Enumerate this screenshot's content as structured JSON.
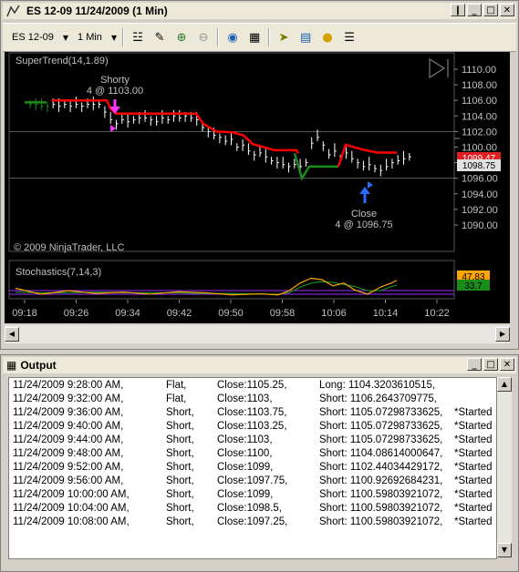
{
  "chart_window": {
    "title": "ES 12-09  11/24/2009 (1 Min)",
    "instrument": "ES 12-09",
    "interval": "1 Min",
    "indicator_label": "SuperTrend(14,1.89)",
    "copyright": "© 2009 NinjaTrader, LLC",
    "stoch_label": "Stochastics(7,14,3)",
    "entry_label": "Shorty",
    "entry_detail": "4 @ 1103.00",
    "exit_label": "Close",
    "exit_detail": "4 @ 1096.75",
    "price_ticks": [
      "1110.00",
      "1108.00",
      "1106.00",
      "1104.00",
      "1102.00",
      "1100.00",
      "1098.00",
      "1096.00",
      "1094.00",
      "1092.00",
      "1090.00"
    ],
    "time_ticks": [
      "09:18",
      "09:26",
      "09:34",
      "09:42",
      "09:50",
      "09:58",
      "10:06",
      "10:14",
      "10:22"
    ],
    "last_price": "1098.75",
    "trend_price": "1099.47",
    "stoch_k": "47.83",
    "stoch_d": "33.7",
    "colors": {
      "uptrend": "#1a8c1a",
      "downtrend": "#ff0000",
      "stoch_k": "#ffa500",
      "stoch_d": "#1a8c1a",
      "level": "#9b30ff",
      "price_bar": "#ffffff"
    }
  },
  "output_window": {
    "title": "Output",
    "rows": [
      [
        "11/24/2009 9:28:00 AM,",
        "Flat,",
        "Close:1105.25,",
        "Long: 1104.3203610515,",
        ""
      ],
      [
        "11/24/2009 9:32:00 AM,",
        "Flat,",
        "Close:1103,",
        "Short: 1106.2643709775,",
        ""
      ],
      [
        "11/24/2009 9:36:00 AM,",
        "Short,",
        "Close:1103.75,",
        "Short: 1105.07298733625,",
        "*Started"
      ],
      [
        "11/24/2009 9:40:00 AM,",
        "Short,",
        "Close:1103.25,",
        "Short: 1105.07298733625,",
        "*Started"
      ],
      [
        "11/24/2009 9:44:00 AM,",
        "Short,",
        "Close:1103,",
        "Short: 1105.07298733625,",
        "*Started"
      ],
      [
        "11/24/2009 9:48:00 AM,",
        "Short,",
        "Close:1100,",
        "Short: 1104.08614000647,",
        "*Started"
      ],
      [
        "11/24/2009 9:52:00 AM,",
        "Short,",
        "Close:1099,",
        "Short: 1102.44034429172,",
        "*Started"
      ],
      [
        "11/24/2009 9:56:00 AM,",
        "Short,",
        "Close:1097.75,",
        "Short: 1100.92692684231,",
        "*Started"
      ],
      [
        "11/24/2009 10:00:00 AM,",
        "Short,",
        "Close:1099,",
        "Short: 1100.59803921072,",
        "*Started"
      ],
      [
        "11/24/2009 10:04:00 AM,",
        "Short,",
        "Close:1098.5,",
        "Short: 1100.59803921072,",
        "*Started"
      ],
      [
        "11/24/2009 10:08:00 AM,",
        "Short,",
        "Close:1097.25,",
        "Short: 1100.59803921072,",
        "*Started"
      ]
    ]
  }
}
